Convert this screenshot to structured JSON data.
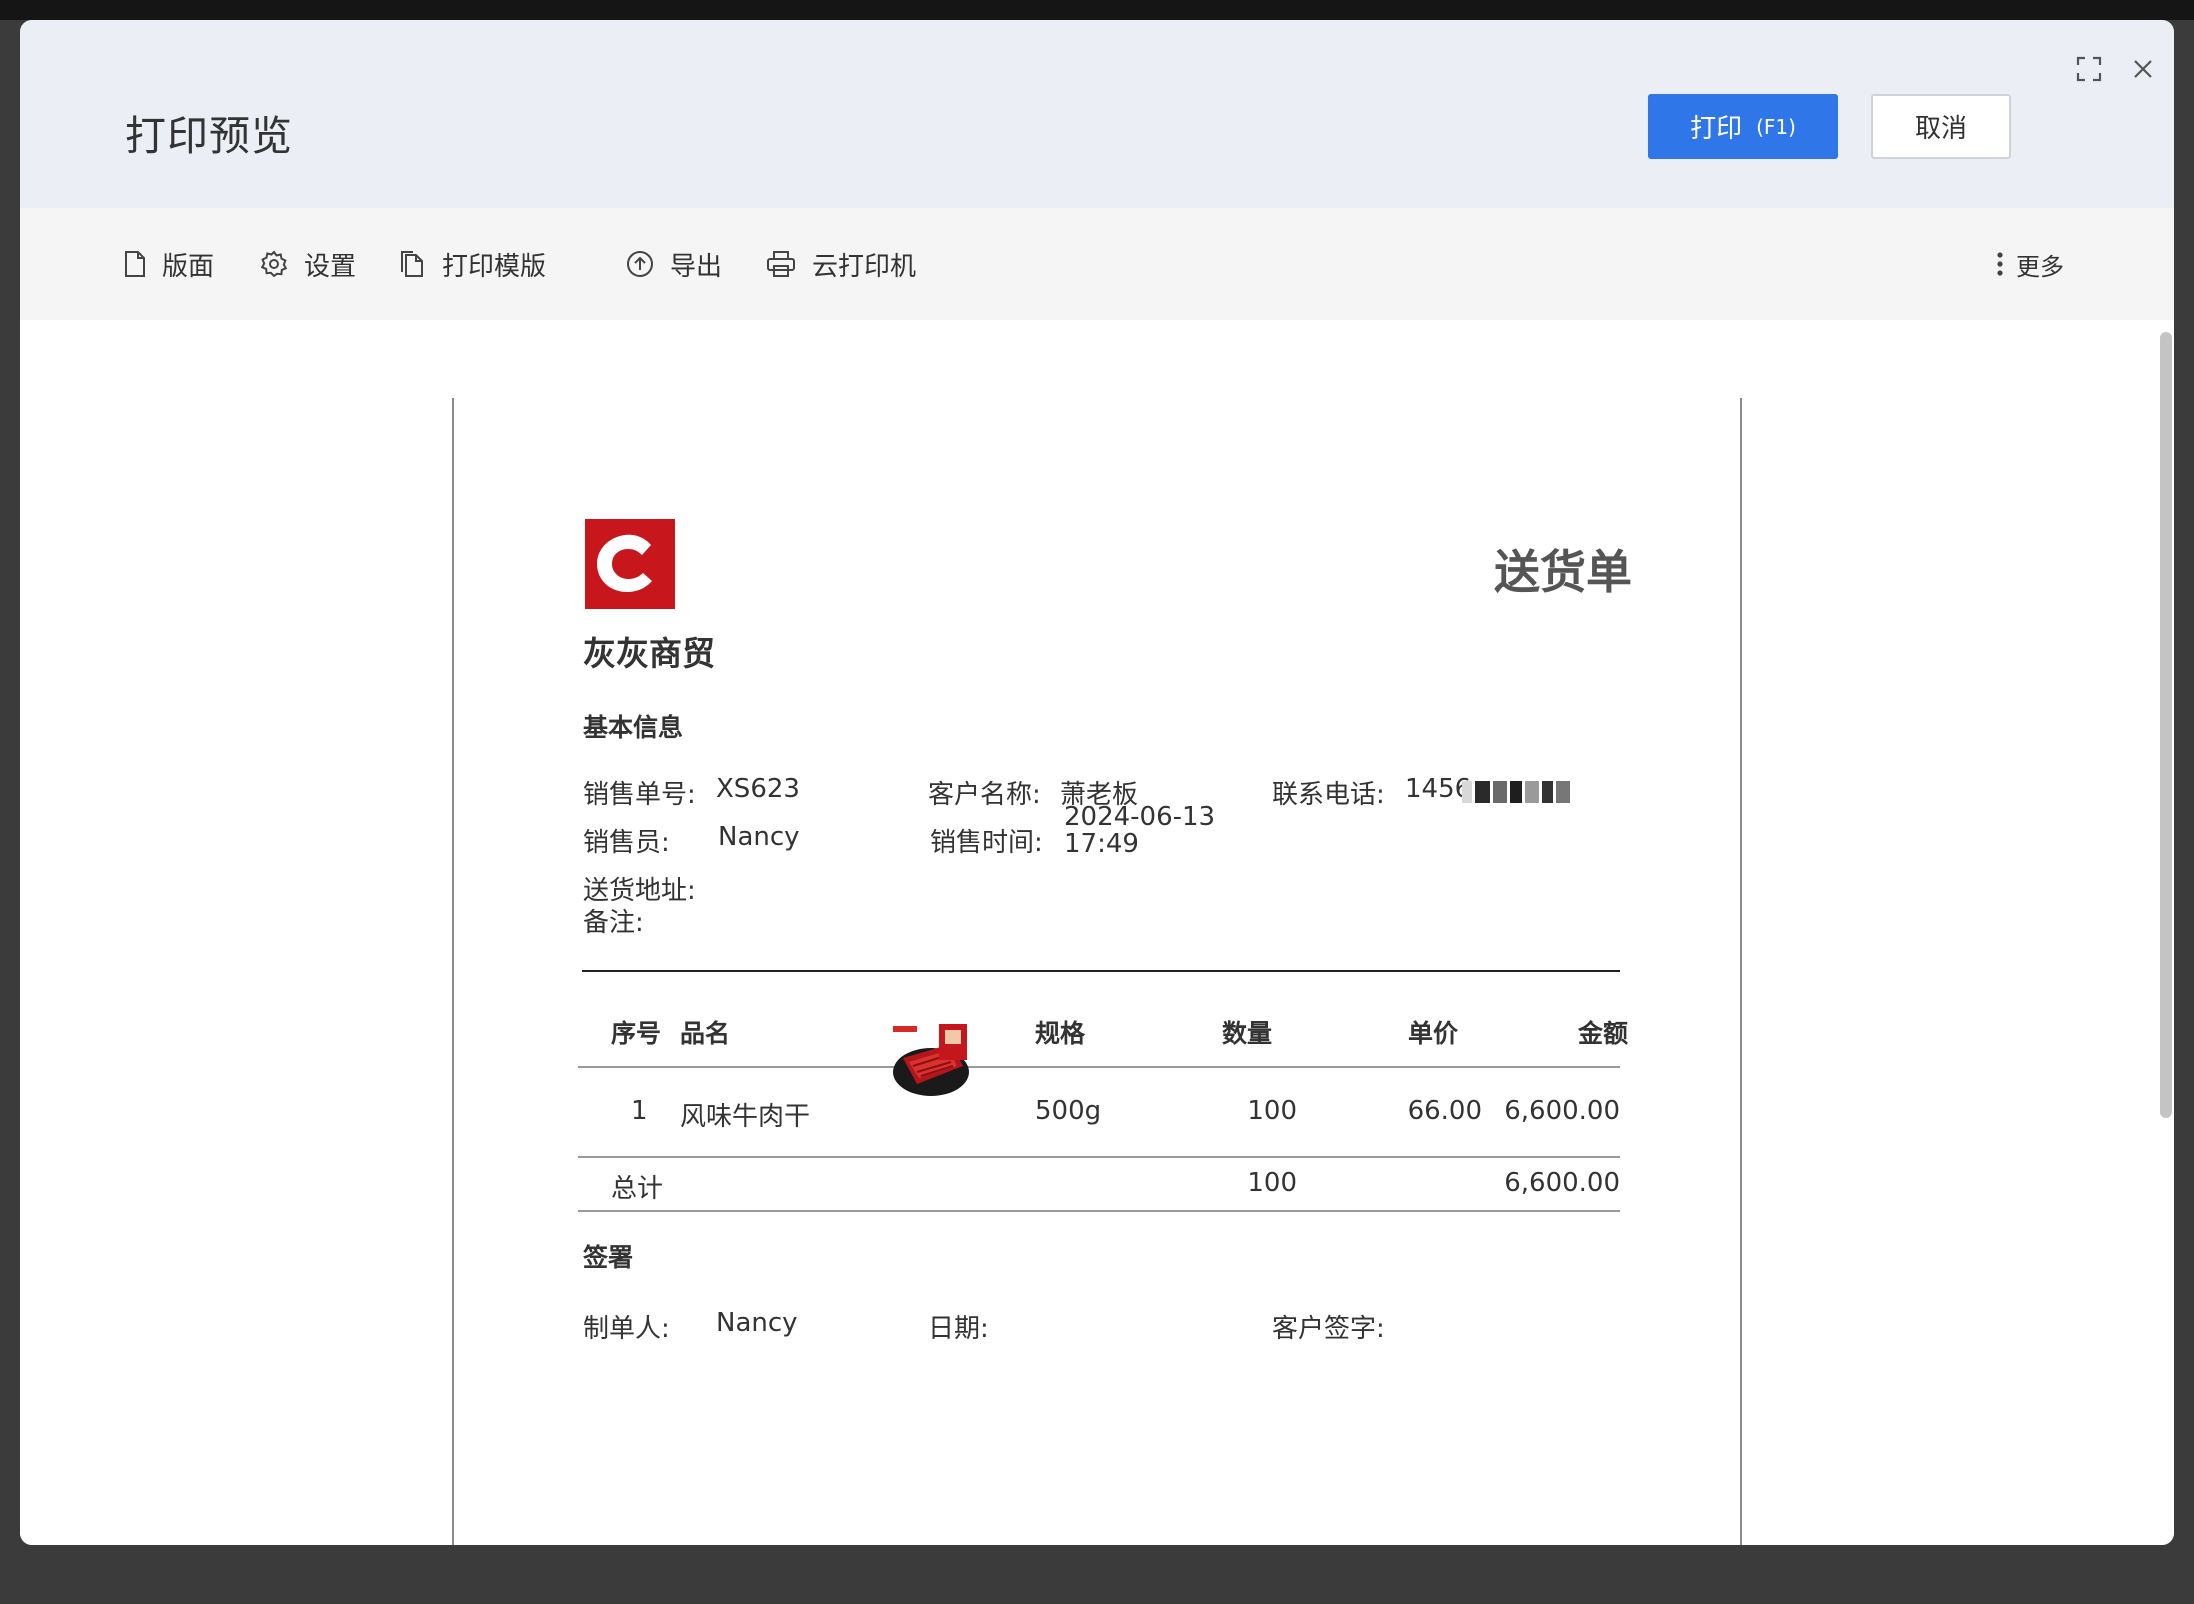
{
  "window": {
    "title": "打印预览",
    "print_button": "打印",
    "print_shortcut": "(F1)",
    "cancel_button": "取消"
  },
  "toolbar": {
    "items": [
      {
        "label": "版面",
        "icon": "page-icon"
      },
      {
        "label": "设置",
        "icon": "gear-icon"
      },
      {
        "label": "打印模版",
        "icon": "template-icon"
      },
      {
        "label": "导出",
        "icon": "upload-icon"
      },
      {
        "label": "云打印机",
        "icon": "printer-icon"
      }
    ],
    "more": "更多"
  },
  "document": {
    "logo_letter": "C",
    "company": "灰灰商贸",
    "title": "送货单",
    "basic_info_title": "基本信息",
    "fields": {
      "order_no_label": "销售单号:",
      "order_no": "XS623",
      "customer_label": "客户名称:",
      "customer": "萧老板",
      "phone_label": "联系电话:",
      "phone": "1456",
      "salesperson_label": "销售员:",
      "salesperson": "Nancy",
      "sale_time_label": "销售时间:",
      "sale_date": "2024-06-13",
      "sale_clock": "17:49",
      "address_label": "送货地址:",
      "note_label": "备注:"
    },
    "table": {
      "headers": [
        "序号",
        "品名",
        "规格",
        "数量",
        "单价",
        "金额"
      ],
      "rows": [
        {
          "index": "1",
          "name": "风味牛肉干",
          "spec": "500g",
          "qty": "100",
          "price": "66.00",
          "amount": "6,600.00",
          "image": "beef-jerky-product-image"
        }
      ],
      "total_label": "总计",
      "total_qty": "100",
      "total_amount": "6,600.00"
    },
    "signature": {
      "title": "签署",
      "maker_label": "制单人:",
      "maker": "Nancy",
      "date_label": "日期:",
      "customer_sign_label": "客户签字:"
    }
  },
  "colors": {
    "primary": "#2f77e8",
    "logo_red": "#c8161d",
    "header_bg": "#ebeef4",
    "toolbar_bg": "#f5f5f5"
  }
}
